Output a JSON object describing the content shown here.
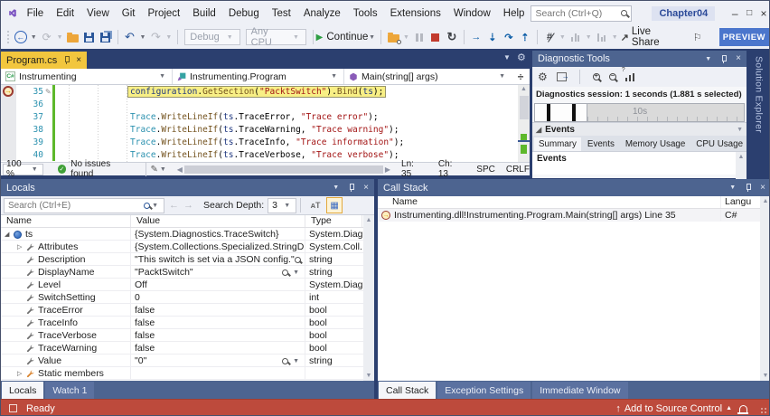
{
  "colors": {
    "active_tab": "#f2c63e",
    "panel_title": "#4d6490",
    "dock_bg": "#2b3f6f",
    "status_bar": "#bd4a3c",
    "preview_button": "#4b76cc",
    "highlight_line": "#f8ef85"
  },
  "title_bar": {
    "menus": [
      "File",
      "Edit",
      "View",
      "Git",
      "Project",
      "Build",
      "Debug",
      "Test",
      "Analyze",
      "Tools",
      "Extensions",
      "Window",
      "Help"
    ],
    "search_placeholder": "Search (Ctrl+Q)",
    "solution_name": "Chapter04"
  },
  "toolbar": {
    "debug_target": "Debug",
    "platform": "Any CPU",
    "continue_label": "Continue",
    "live_share_label": "Live Share",
    "preview_label": "PREVIEW"
  },
  "editor": {
    "tab_title": "Program.cs",
    "breadcrumbs": [
      "Instrumenting",
      "Instrumenting.Program",
      "Main(string[] args)"
    ],
    "lines": [
      {
        "num": "35",
        "current": true,
        "pencil": true,
        "highlight": true,
        "tokens": [
          {
            "c": "v",
            "t": "configuration"
          },
          {
            "c": "p",
            "t": "."
          },
          {
            "c": "m",
            "t": "GetSection"
          },
          {
            "c": "p",
            "t": "("
          },
          {
            "c": "s",
            "t": "\"PacktSwitch\""
          },
          {
            "c": "p",
            "t": ")."
          },
          {
            "c": "m",
            "t": "Bind"
          },
          {
            "c": "p",
            "t": "("
          },
          {
            "c": "v",
            "t": "ts"
          },
          {
            "c": "p",
            "t": ");"
          }
        ]
      },
      {
        "num": "36",
        "tokens": []
      },
      {
        "num": "37",
        "tokens": [
          {
            "c": "cls",
            "t": "Trace"
          },
          {
            "c": "p",
            "t": "."
          },
          {
            "c": "m",
            "t": "WriteLineIf"
          },
          {
            "c": "p",
            "t": "("
          },
          {
            "c": "v",
            "t": "ts"
          },
          {
            "c": "p",
            "t": ".TraceError, "
          },
          {
            "c": "s",
            "t": "\"Trace error\""
          },
          {
            "c": "p",
            "t": ");"
          }
        ]
      },
      {
        "num": "38",
        "tokens": [
          {
            "c": "cls",
            "t": "Trace"
          },
          {
            "c": "p",
            "t": "."
          },
          {
            "c": "m",
            "t": "WriteLineIf"
          },
          {
            "c": "p",
            "t": "("
          },
          {
            "c": "v",
            "t": "ts"
          },
          {
            "c": "p",
            "t": ".TraceWarning, "
          },
          {
            "c": "s",
            "t": "\"Trace warning\""
          },
          {
            "c": "p",
            "t": ");"
          }
        ]
      },
      {
        "num": "39",
        "tokens": [
          {
            "c": "cls",
            "t": "Trace"
          },
          {
            "c": "p",
            "t": "."
          },
          {
            "c": "m",
            "t": "WriteLineIf"
          },
          {
            "c": "p",
            "t": "("
          },
          {
            "c": "v",
            "t": "ts"
          },
          {
            "c": "p",
            "t": ".TraceInfo, "
          },
          {
            "c": "s",
            "t": "\"Trace information\""
          },
          {
            "c": "p",
            "t": ");"
          }
        ]
      },
      {
        "num": "40",
        "tokens": [
          {
            "c": "cls",
            "t": "Trace"
          },
          {
            "c": "p",
            "t": "."
          },
          {
            "c": "m",
            "t": "WriteLineIf"
          },
          {
            "c": "p",
            "t": "("
          },
          {
            "c": "v",
            "t": "ts"
          },
          {
            "c": "p",
            "t": ".TraceVerbose, "
          },
          {
            "c": "s",
            "t": "\"Trace verbose\""
          },
          {
            "c": "p",
            "t": ");"
          }
        ]
      }
    ],
    "status": {
      "zoom": "100 %",
      "issues": "No issues found",
      "ln": "Ln: 35",
      "ch": "Ch: 13",
      "spc": "SPC",
      "eol": "CRLF"
    }
  },
  "diagnostics": {
    "title": "Diagnostic Tools",
    "session_text": "Diagnostics session: 1 seconds (1.881 s selected)",
    "timeline_label": "10s",
    "events_header": "Events",
    "tabs": [
      "Summary",
      "Events",
      "Memory Usage",
      "CPU Usage"
    ],
    "active_tab": "Summary",
    "section_title": "Events"
  },
  "solution_explorer_label": "Solution Explorer",
  "locals": {
    "title": "Locals",
    "search_placeholder": "Search (Ctrl+E)",
    "depth_label": "Search Depth:",
    "depth_value": "3",
    "columns": [
      "Name",
      "Value",
      "Type"
    ],
    "rows": [
      {
        "level": 0,
        "expand": "expanded",
        "icon": "object",
        "name": "ts",
        "value": "{System.Diagnostics.TraceSwitch}",
        "type": "System.Diag...",
        "mag": false
      },
      {
        "level": 1,
        "expand": "collapsed",
        "icon": "wrench",
        "name": "Attributes",
        "value": "{System.Collections.Specialized.StringDic...",
        "type": "System.Coll...",
        "mag": false
      },
      {
        "level": 1,
        "icon": "wrench",
        "name": "Description",
        "value": "\"This switch is set via a JSON config.\"",
        "type": "string",
        "mag": true
      },
      {
        "level": 1,
        "icon": "wrench",
        "name": "DisplayName",
        "value": "\"PacktSwitch\"",
        "type": "string",
        "mag": true
      },
      {
        "level": 1,
        "icon": "wrench",
        "name": "Level",
        "value": "Off",
        "type": "System.Diag...",
        "mag": false
      },
      {
        "level": 1,
        "icon": "wrench",
        "name": "SwitchSetting",
        "value": "0",
        "type": "int",
        "mag": false
      },
      {
        "level": 1,
        "icon": "wrench",
        "name": "TraceError",
        "value": "false",
        "type": "bool",
        "mag": false
      },
      {
        "level": 1,
        "icon": "wrench",
        "name": "TraceInfo",
        "value": "false",
        "type": "bool",
        "mag": false
      },
      {
        "level": 1,
        "icon": "wrench",
        "name": "TraceVerbose",
        "value": "false",
        "type": "bool",
        "mag": false
      },
      {
        "level": 1,
        "icon": "wrench",
        "name": "TraceWarning",
        "value": "false",
        "type": "bool",
        "mag": false
      },
      {
        "level": 1,
        "icon": "wrench",
        "name": "Value",
        "value": "\"0\"",
        "type": "string",
        "mag": true
      },
      {
        "level": 1,
        "expand": "collapsed",
        "icon": "static",
        "name": "Static members",
        "value": "",
        "type": "",
        "mag": false
      }
    ],
    "tabs": [
      "Locals",
      "Watch 1"
    ],
    "active_tab": "Locals"
  },
  "call_stack": {
    "title": "Call Stack",
    "columns": [
      "Name",
      "Langu"
    ],
    "frames": [
      {
        "name": "Instrumenting.dll!Instrumenting.Program.Main(string[] args) Line 35",
        "lang": "C#",
        "current": true
      }
    ],
    "tabs": [
      "Call Stack",
      "Exception Settings",
      "Immediate Window"
    ],
    "active_tab": "Call Stack"
  },
  "status_bar": {
    "ready": "Ready",
    "source_control": "Add to Source Control"
  }
}
